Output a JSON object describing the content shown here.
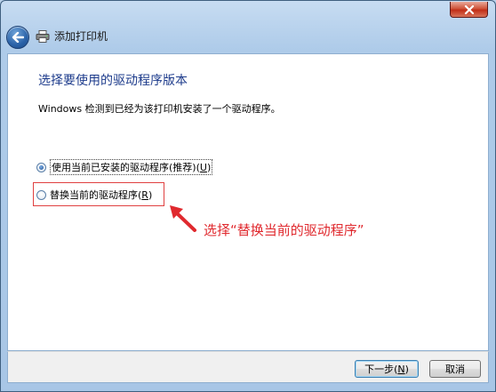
{
  "window": {
    "title": "添加打印机"
  },
  "main": {
    "heading": "选择要使用的驱动程序版本",
    "description": "Windows 检测到已经为该打印机安装了一个驱动程序。",
    "options": [
      {
        "label": "使用当前已安装的驱动程序(推荐)(",
        "mnemonic": "U",
        "suffix": ")",
        "checked": true
      },
      {
        "label": "替换当前的驱动程序(",
        "mnemonic": "R",
        "suffix": ")",
        "checked": false
      }
    ]
  },
  "annotation": {
    "text": "选择“替换当前的驱动程序”",
    "color": "#e0292e"
  },
  "footer": {
    "next_label": "下一步(",
    "next_mnemonic": "N",
    "next_suffix": ")",
    "cancel_label": "取消"
  },
  "icons": {
    "back": "back-arrow-icon",
    "printer": "printer-icon",
    "close": "close-icon"
  }
}
